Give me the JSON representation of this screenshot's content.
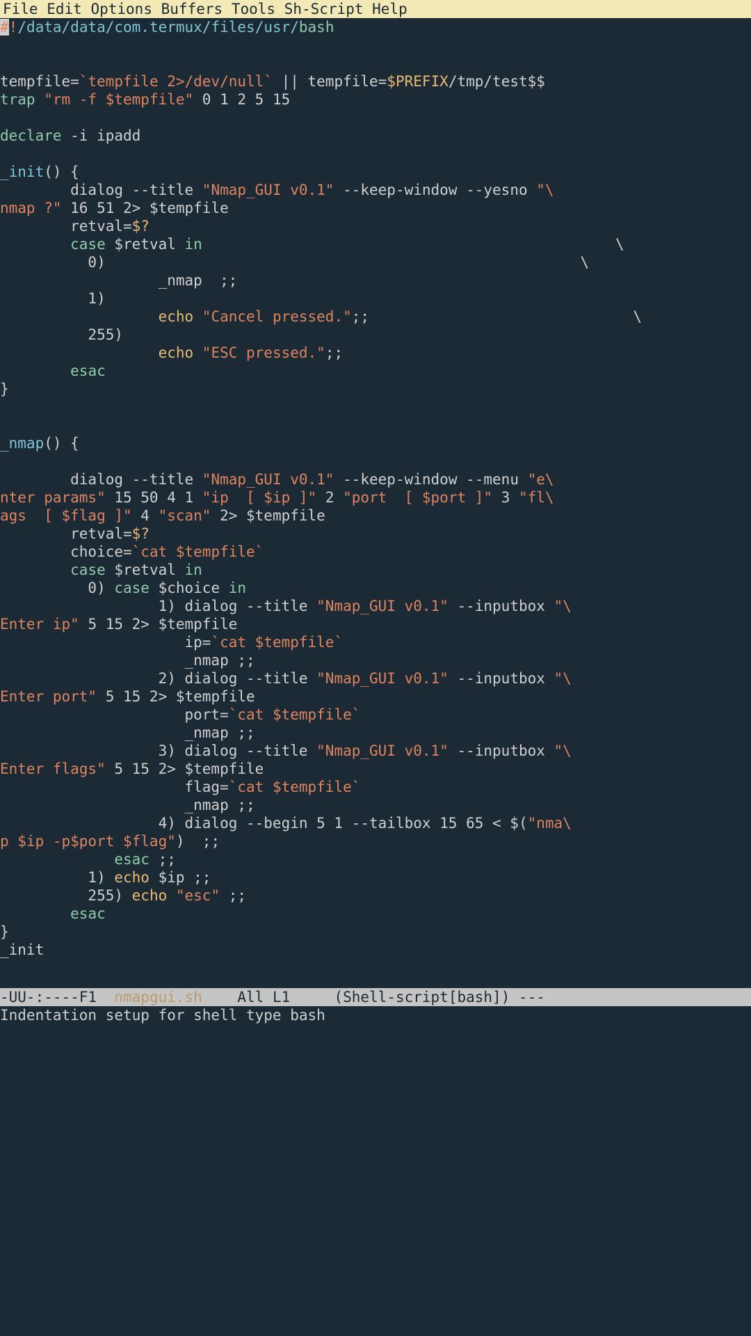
{
  "menu": {
    "file": "File",
    "edit": "Edit",
    "options": "Options",
    "buffers": "Buffers",
    "tools": "Tools",
    "mode": "Sh-Script",
    "help": "Help"
  },
  "shebang": {
    "hash": "#",
    "bang": "!",
    "path": "/data/data/com.termux/files/usr/",
    "interp": "bash"
  },
  "src": {
    "l3a": "tempfile=",
    "l3b": "`tempfile 2>/dev/null`",
    "l3c": " || tempfile=",
    "l3d": "$PREFIX",
    "l3e": "/tmp/test$$",
    "l4a": "trap",
    "l4b": " \"rm -f $tempfile\"",
    "l4c": " 0 1 2 5 15",
    "l5a": "declare",
    "l5b": " -i ipadd",
    "l6a": "_init",
    "l6b": "() {",
    "l7a": "        dialog --title ",
    "l7b": "\"Nmap_GUI v0.1\"",
    "l7c": " --keep-window --yesno ",
    "l7d": "\"\\",
    "l8a": "nmap ?\"",
    "l8b": " 16 51 2> $tempfile",
    "l9a": "        retval=",
    "l9b": "$?",
    "l10a": "        ",
    "l10b": "case",
    "l10c": " $retval ",
    "l10d": "in",
    "l10e": "                                               \\",
    "l11": "          0)                                                      \\",
    "l12": "                  _nmap  ;;",
    "l13": "          1)",
    "l14a": "                  ",
    "l14b": "echo",
    "l14c": " \"Cancel pressed.\"",
    "l14d": ";;                              \\",
    "l15": "          255)",
    "l16a": "                  ",
    "l16b": "echo",
    "l16c": " \"ESC pressed.\"",
    "l16d": ";;",
    "l17a": "        ",
    "l17b": "esac",
    "l18": "}",
    "l19a": "_nmap",
    "l19b": "() {",
    "l20a": "        dialog --title ",
    "l20b": "\"Nmap_GUI v0.1\"",
    "l20c": " --keep-window --menu ",
    "l20d": "\"e\\",
    "l21a": "nter params\"",
    "l21b": " 15 50 4 1 ",
    "l21c": "\"ip  [ $ip ]\"",
    "l21d": " 2 ",
    "l21e": "\"port  [ $port ]\"",
    "l21f": " 3 ",
    "l21g": "\"fl\\",
    "l22a": "ags  [ $flag ]\"",
    "l22b": " 4 ",
    "l22c": "\"scan\"",
    "l22d": " 2> $tempfile",
    "l23a": "        retval=",
    "l23b": "$?",
    "l24a": "        choice=",
    "l24b": "`cat $tempfile`",
    "l25a": "        ",
    "l25b": "case",
    "l25c": " $retval ",
    "l25d": "in",
    "l26a": "          0) ",
    "l26b": "case",
    "l26c": " $choice ",
    "l26d": "in",
    "l27a": "                  1) dialog --title ",
    "l27b": "\"Nmap_GUI v0.1\"",
    "l27c": " --inputbox ",
    "l27d": "\"\\",
    "l28a": "Enter ip\"",
    "l28b": " 5 15 2> $tempfile",
    "l29a": "                     ip=",
    "l29b": "`cat $tempfile`",
    "l30": "                     _nmap ;;",
    "l31a": "                  2) dialog --title ",
    "l31b": "\"Nmap_GUI v0.1\"",
    "l31c": " --inputbox ",
    "l31d": "\"\\",
    "l32a": "Enter port\"",
    "l32b": " 5 15 2> $tempfile",
    "l33a": "                     port=",
    "l33b": "`cat $tempfile`",
    "l34": "                     _nmap ;;",
    "l35a": "                  3) dialog --title ",
    "l35b": "\"Nmap_GUI v0.1\"",
    "l35c": " --inputbox ",
    "l35d": "\"\\",
    "l36a": "Enter flags\"",
    "l36b": " 5 15 2> $tempfile",
    "l37a": "                     flag=",
    "l37b": "`cat $tempfile`",
    "l38": "                     _nmap ;;",
    "l39a": "                  4) dialog --begin 5 1 --tailbox 15 65 < $(",
    "l39b": "\"nma\\",
    "l40a": "p $ip -p$port $flag\"",
    "l40b": ")  ;;",
    "l41a": "             ",
    "l41b": "esac",
    "l41c": " ;;",
    "l42a": "          1) ",
    "l42b": "echo",
    "l42c": " $ip ;;",
    "l43a": "          255) ",
    "l43b": "echo",
    "l43c": " \"esc\"",
    "l43d": " ;;",
    "l44a": "        ",
    "l44b": "esac",
    "l45": "}",
    "l46": "_init"
  },
  "modeline": {
    "left": "-UU-:----F1  ",
    "fname": "nmapgui.sh",
    "mid": "    All L1     (",
    "mode": "Shell-script[bash]",
    "right": ") ---"
  },
  "echo": "Indentation setup for shell type bash"
}
